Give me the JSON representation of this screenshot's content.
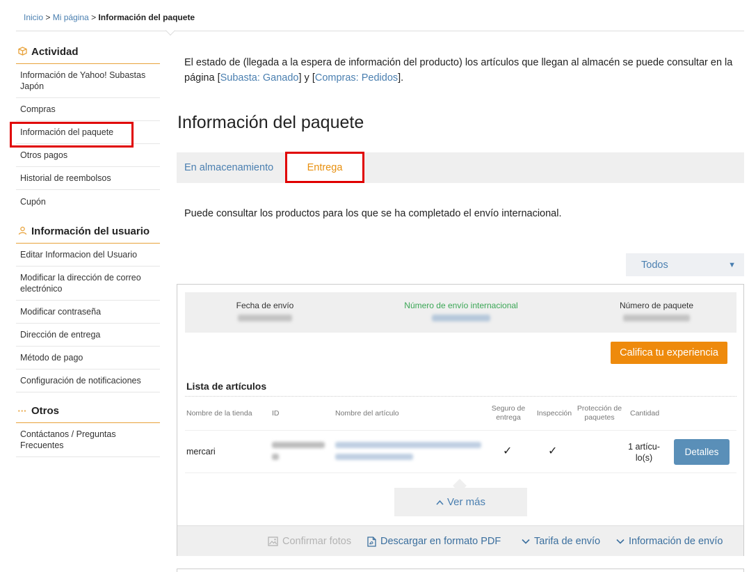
{
  "breadcrumb": {
    "home": "Inicio",
    "sep1": " > ",
    "mypage": "Mi página",
    "sep2": " > ",
    "current": "Información del paquete"
  },
  "sidebar": {
    "activity": {
      "title": "Actividad",
      "icon": "box-icon",
      "items": [
        "Información de Yahoo! Subastas Japón",
        "Compras",
        "Información del paquete",
        "Otros pagos",
        "Historial de reembolsos",
        "Cupón"
      ]
    },
    "user": {
      "title": "Información del usuario",
      "icon": "user-icon",
      "items": [
        "Editar Informacion del Usuario",
        "Modificar la dirección de correo electrónico",
        "Modificar contraseña",
        "Dirección de entrega",
        "Método de pago",
        "Configuración de notificaciones"
      ]
    },
    "others": {
      "title": "Otros",
      "icon": "dots-icon",
      "items": [
        "Contáctanos / Preguntas Frecuentes"
      ]
    }
  },
  "intro": {
    "before": "El estado de (llegada a la espera de información del producto) los artículos que llegan al almacén se puede consultar en la página [",
    "link1": "Subasta: Ganado",
    "mid": "] y [",
    "link2": "Compras: Pedidos",
    "after": "]."
  },
  "page_title": "Información del paquete",
  "tabs": [
    "En almacenamiento",
    "Entrega"
  ],
  "active_tab": "Entrega",
  "description": "Puede consultar los productos para los que se ha completado el envío internacional.",
  "filter": {
    "value": "Todos",
    "icon": "caret-down-icon"
  },
  "package": {
    "labels": {
      "ship_date": "Fecha de envío",
      "intl_number": "Número de envío internacional",
      "package_number": "Número de paquete"
    },
    "rate_button": "Califica tu experiencia",
    "list_title": "Lista de artículos",
    "columns": {
      "store": "Nombre de la tienda",
      "id": "ID",
      "item_name": "Nombre del artículo",
      "insurance": "Seguro de entrega",
      "inspection": "Inspección",
      "protection": "Protección de paquetes",
      "quantity": "Cantidad"
    },
    "row": {
      "store": "mercari",
      "insurance": "✓",
      "inspection": "✓",
      "quantity": "1 artícu-lo(s)",
      "details_button": "Detalles"
    },
    "more_button": "Ver más",
    "footer": {
      "photos": "Confirmar fotos",
      "pdf": "Descargar en formato PDF",
      "rate": "Tarifa de envío",
      "info": "Información de envío"
    }
  },
  "colors": {
    "accent": "#e8900f",
    "link": "#4a7fb0",
    "highlight": "#e00000",
    "button_blue": "#5a8fb8"
  }
}
